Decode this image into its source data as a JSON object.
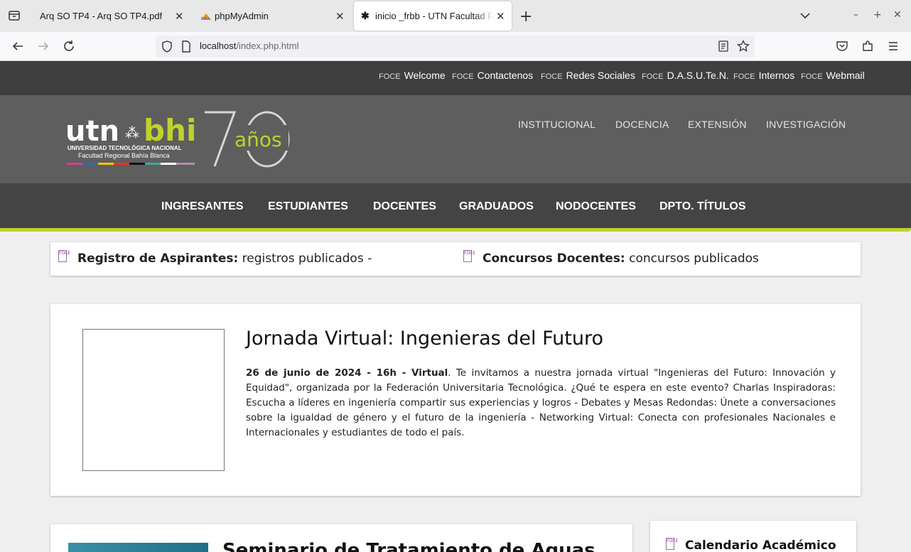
{
  "browser": {
    "tabs": [
      {
        "title": "Arq SO TP4 - Arq SO TP4.pdf",
        "close": "✕"
      },
      {
        "title": "phpMyAdmin",
        "close": "✕"
      },
      {
        "title": "inicio _frbb - UTN Facultad Regional Bahía Blanca",
        "close": "✕"
      }
    ],
    "new_tab": "+",
    "url_host": "localhost",
    "url_path": "/index.php.html",
    "window_controls": {
      "minimize": "–",
      "restore": "+",
      "close": "✕"
    }
  },
  "site": {
    "top_links": [
      {
        "icon": "FOCE",
        "label": "Welcome"
      },
      {
        "icon": "FOCE",
        "label": "Contactenos"
      },
      {
        "icon": "FOCE",
        "label": "Redes Sociales"
      },
      {
        "icon": "FOCE",
        "label": "D.A.S.U.Te.N."
      },
      {
        "icon": "FOCE",
        "label": "Internos"
      },
      {
        "icon": "FOCE",
        "label": "Webmail"
      }
    ],
    "logo": {
      "utn": "utn",
      "bhi": "bhi",
      "line1": "UNIVERSIDAD TECNOLÓGICA NACIONAL",
      "line2": "Facultad Regional Bahía Blanca",
      "anniversary": "años",
      "number": "70"
    },
    "header_links": [
      "INSTITUCIONAL",
      "DOCENCIA",
      "EXTENSIÓN",
      "INVESTIGACIÓN"
    ],
    "main_nav": [
      "INGRESANTES",
      "ESTUDIANTES",
      "DOCENTES",
      "GRADUADOS",
      "NODOCENTES",
      "DPTO. TÍTULOS"
    ],
    "ticker": [
      {
        "icon": "FOCE",
        "bold": "Registro de Aspirantes:",
        "text": " registros publicados -"
      },
      {
        "icon": "FOCE",
        "bold": "Concursos Docentes:",
        "text": " concursos publicados"
      }
    ],
    "news": {
      "title": "Jornada Virtual: Ingenieras del Futuro",
      "date_bold": "26 de junio de 2024 - 16h - Virtual",
      "body": ". Te invitamos a nuestra jornada virtual \"Ingenieras del Futuro: Innovación y Equidad\", organizada por la Federación Universitaria Tecnológica. ¿Qué te espera en este evento? Charlas Inspiradoras: Escucha a líderes en ingeniería compartir sus experiencias y logros - Debates y Mesas Redondas: Únete a conversaciones sobre la igualdad de género y el futuro de la ingeniería - Networking Virtual: Conecta con profesionales Nacionales e Internacionales y estudiantes de todo el país."
    },
    "news2_title": "Seminario de Tratamiento de Aguas",
    "sidebar_title": "Calendario Académico"
  },
  "colors": {
    "accent": "#bfd22b",
    "topbar": "#3f3f3f",
    "header": "#5e5e5e",
    "nav": "#444444"
  }
}
